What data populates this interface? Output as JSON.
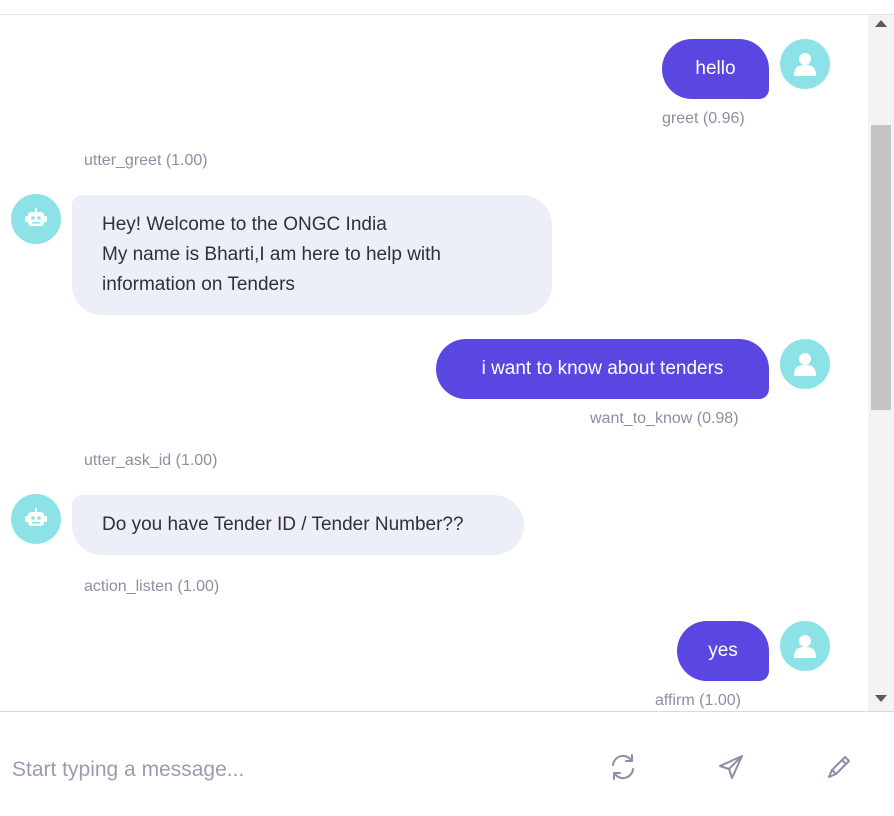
{
  "colors": {
    "user_bubble": "#5a46e0",
    "bot_bubble": "#eceff7",
    "avatar": "#8ce2e6",
    "meta_text": "#8c8ea4"
  },
  "messages": [
    {
      "sender": "user",
      "text": "hello",
      "meta": "greet (0.96)",
      "avatar_icon": "user-icon"
    },
    {
      "sender": "bot",
      "action": "utter_greet (1.00)",
      "lines": [
        "Hey! Welcome to the ONGC India",
        "My name is Bharti,I am here to help with",
        "information on Tenders"
      ],
      "avatar_icon": "robot-icon"
    },
    {
      "sender": "user",
      "text": "i want to know about tenders",
      "meta": "want_to_know (0.98)",
      "avatar_icon": "user-icon"
    },
    {
      "sender": "bot",
      "action": "utter_ask_id (1.00)",
      "lines": [
        "Do you have Tender ID / Tender Number??"
      ],
      "avatar_icon": "robot-icon"
    },
    {
      "sender": "system",
      "action": "action_listen (1.00)"
    },
    {
      "sender": "user",
      "text": "yes",
      "meta": "affirm (1.00)",
      "avatar_icon": "user-icon"
    }
  ],
  "composer": {
    "placeholder": "Start typing a message...",
    "buttons": [
      "refresh-icon",
      "send-icon",
      "pen-icon"
    ]
  }
}
